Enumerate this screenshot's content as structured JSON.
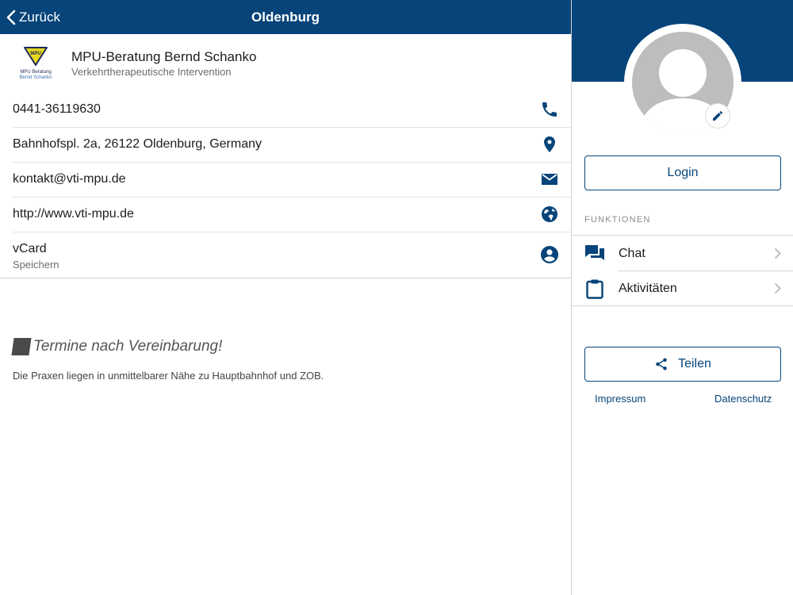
{
  "colors": {
    "primary": "#064479",
    "avatar_gray": "#bdbdbd",
    "logo_yellow": "#e6d81e"
  },
  "nav": {
    "back_label": "Zurück",
    "title": "Oldenburg",
    "back_icon": "chevron-left-icon"
  },
  "company": {
    "name": "MPU-Beratung Bernd Schanko",
    "subtitle": "Verkehrtherapeutische Intervention",
    "logo": {
      "badge_text": "MPU",
      "line1": "MPU Beratung",
      "line2": "Bernd Schanko"
    }
  },
  "contacts": [
    {
      "text": "0441-36119630",
      "icon": "phone-icon"
    },
    {
      "text": "Bahnhofspl. 2a, 26122 Oldenburg, Germany",
      "icon": "map-pin-icon"
    },
    {
      "text": "kontakt@vti-mpu.de",
      "icon": "mail-icon"
    },
    {
      "text": "http://www.vti-mpu.de",
      "icon": "globe-icon"
    },
    {
      "title": "vCard",
      "subtitle": "Speichern",
      "icon": "account-circle-icon"
    }
  ],
  "content": {
    "heading": "Termine nach Vereinbarung!",
    "note": "Die Praxen liegen in unmittelbarer Nähe zu Hauptbahnhof und ZOB."
  },
  "sidebar": {
    "login_label": "Login",
    "functions_label": "FUNKTIONEN",
    "functions": [
      {
        "label": "Chat",
        "icon": "chat-icon"
      },
      {
        "label": "Aktivitäten",
        "icon": "clipboard-icon"
      }
    ],
    "share_label": "Teilen",
    "impressum_label": "Impressum",
    "datenschutz_label": "Datenschutz"
  }
}
